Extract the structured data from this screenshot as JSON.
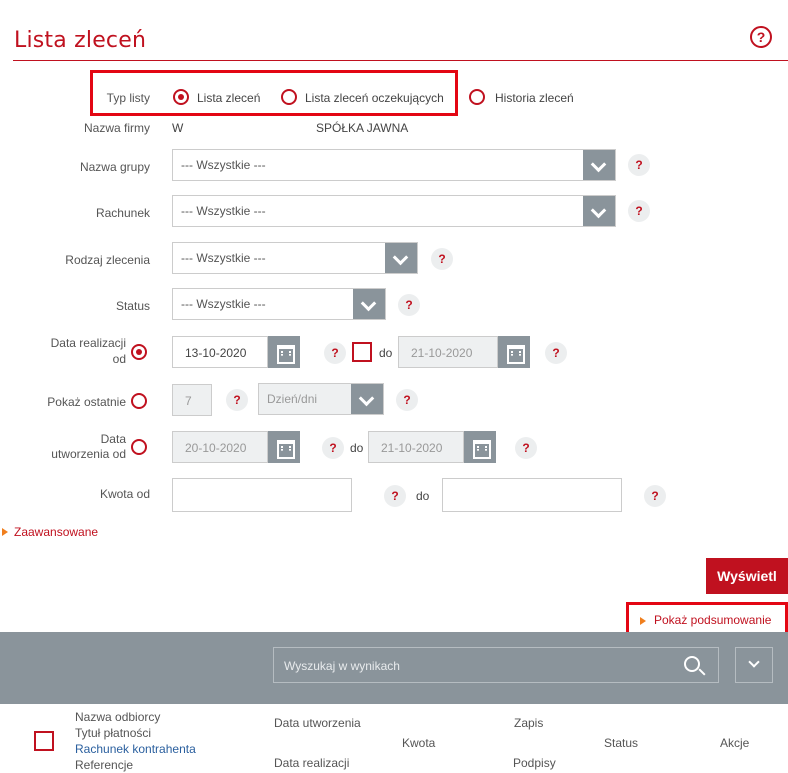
{
  "page": {
    "title": "Lista zleceń",
    "help": "?"
  },
  "typ_listy": {
    "label": "Typ listy",
    "options": [
      {
        "label": "Lista zleceń",
        "selected": true
      },
      {
        "label": "Lista zleceń oczekujących",
        "selected": false
      },
      {
        "label": "Historia zleceń",
        "selected": false
      }
    ]
  },
  "firma": {
    "label": "Nazwa firmy",
    "value_prefix": "W",
    "value_suffix": "SPÓŁKA JAWNA"
  },
  "grupa": {
    "label": "Nazwa grupy",
    "value": "--- Wszystkie ---"
  },
  "rachunek": {
    "label": "Rachunek",
    "value": "--- Wszystkie ---"
  },
  "rodzaj": {
    "label": "Rodzaj zlecenia",
    "value": "--- Wszystkie ---"
  },
  "status": {
    "label": "Status",
    "value": "--- Wszystkie ---"
  },
  "data_realizacji": {
    "label_line1": "Data realizacji",
    "label_line2": "od",
    "from": "13-10-2020",
    "to_label": "do",
    "to": "21-10-2020",
    "selected": true
  },
  "pokaz_ostatnie": {
    "label": "Pokaż ostatnie",
    "value": "7",
    "unit": "Dzień/dni",
    "selected": false
  },
  "data_utworzenia": {
    "label_line1": "Data",
    "label_line2": "utworzenia od",
    "from": "20-10-2020",
    "to_label": "do",
    "to": "21-10-2020",
    "selected": false
  },
  "kwota": {
    "label": "Kwota od",
    "to_label": "do",
    "from": "",
    "to": ""
  },
  "advanced": {
    "label": "Zaawansowane"
  },
  "show_button": {
    "label": "Wyświetl"
  },
  "summary": {
    "label": "Pokaż podsumowanie"
  },
  "search": {
    "placeholder": "Wyszukaj w wynikach"
  },
  "table_header": {
    "col1_line1": "Nazwa odbiorcy",
    "col1_line2": "Tytuł płatności",
    "col1_line3": "Rachunek kontrahenta",
    "col1_line4": "Referencje",
    "col2_line1": "Data utworzenia",
    "col2_line2": "Data realizacji",
    "col3": "Kwota",
    "col4_line1": "Zapis",
    "col4_line2": "Podpisy",
    "col5": "Status",
    "col6": "Akcje"
  },
  "colors": {
    "accent": "#c0111f",
    "highlight": "#e30613",
    "toolbar": "#8a949b",
    "link_blue": "#2a5f9e"
  }
}
